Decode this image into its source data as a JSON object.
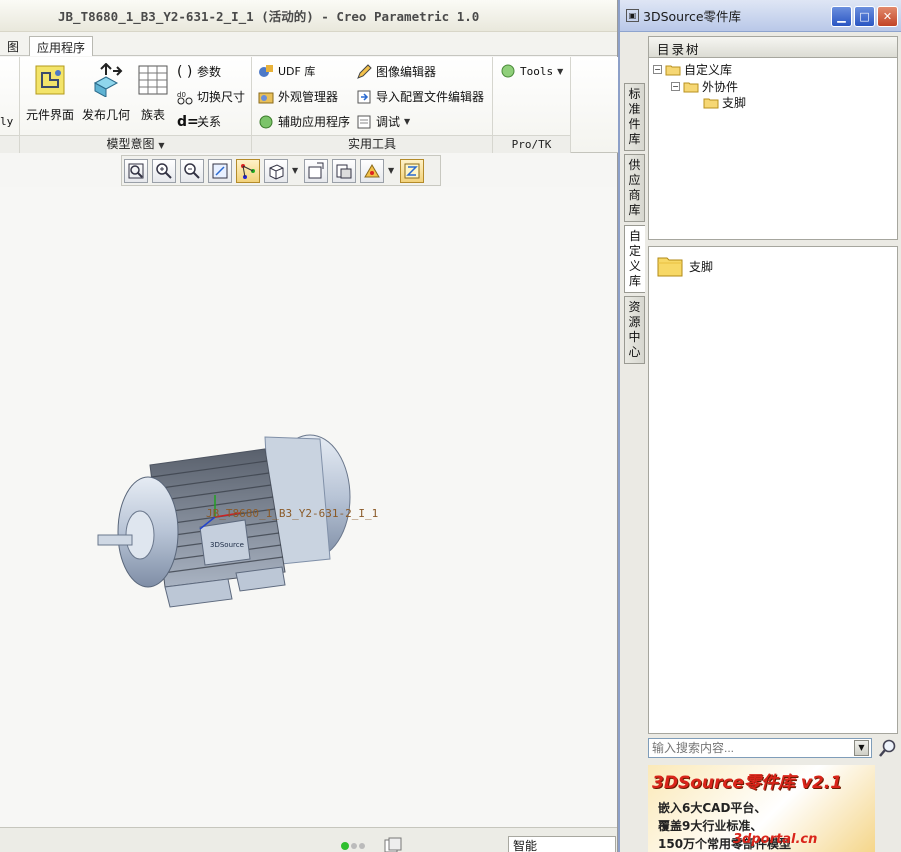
{
  "creo": {
    "title": "JB_T8680_1_B3_Y2-631-2_I_1 (活动的) - Creo Parametric 1.0",
    "tabs": [
      {
        "label": "图"
      },
      {
        "label": "应用程序",
        "active": true
      }
    ],
    "ribbon": {
      "partial_left_label": "ly",
      "model_intent": {
        "label": "模型意图",
        "big_buttons": [
          "元件界面",
          "发布几何",
          "族表"
        ],
        "small_buttons": [
          "参数",
          "切换尺寸",
          "关系"
        ]
      },
      "utilities": {
        "label": "实用工具",
        "buttons": [
          "UDF 库",
          "外观管理器",
          "辅助应用程序",
          "图像编辑器",
          "导入配置文件编辑器",
          "调试"
        ]
      },
      "protk": {
        "label": "Pro/TK",
        "buttons": [
          "Tools"
        ]
      }
    },
    "view_toolbar": {
      "icons": [
        "zoom-fit-icon",
        "zoom-in-icon",
        "zoom-out-icon",
        "repaint-icon",
        "datum-display-icon",
        "display-style-icon",
        "saved-views-icon",
        "layers-icon",
        "spin-center-icon",
        "annotation-display-icon"
      ]
    },
    "model_annotation": "JB_T8680_1_B3_Y2-631-2_I_1",
    "nameplate": "3DSource",
    "status": {
      "mode_label": "智能"
    }
  },
  "panel": {
    "title": "3DSource零件库",
    "side_tabs": [
      {
        "label": "标准件库"
      },
      {
        "label": "供应商库"
      },
      {
        "label": "自定义库",
        "active": true
      },
      {
        "label": "资源中心"
      }
    ],
    "tree_header": "目录树",
    "tree": [
      {
        "label": "自定义库",
        "level": 0,
        "expander": "⊟"
      },
      {
        "label": "外协件",
        "level": 1,
        "expander": "⊟"
      },
      {
        "label": "支脚",
        "level": 2
      }
    ],
    "files": [
      {
        "label": "支脚"
      }
    ],
    "search": {
      "placeholder": "输入搜索内容..."
    },
    "banner": {
      "logo": "3DSource零件库 v2.1",
      "lines": [
        "嵌入6大CAD平台、",
        "覆盖9大行业标准、",
        "150万个常用零部件模型"
      ],
      "url": "3dportal.cn"
    }
  },
  "colors": {
    "titlebar_text": "#4a4a4a",
    "panel_title_bg": "#b9c8e8",
    "close_button": "#c24427",
    "banner_accent": "#d9241a",
    "motor_body": "#b8c4d6"
  }
}
